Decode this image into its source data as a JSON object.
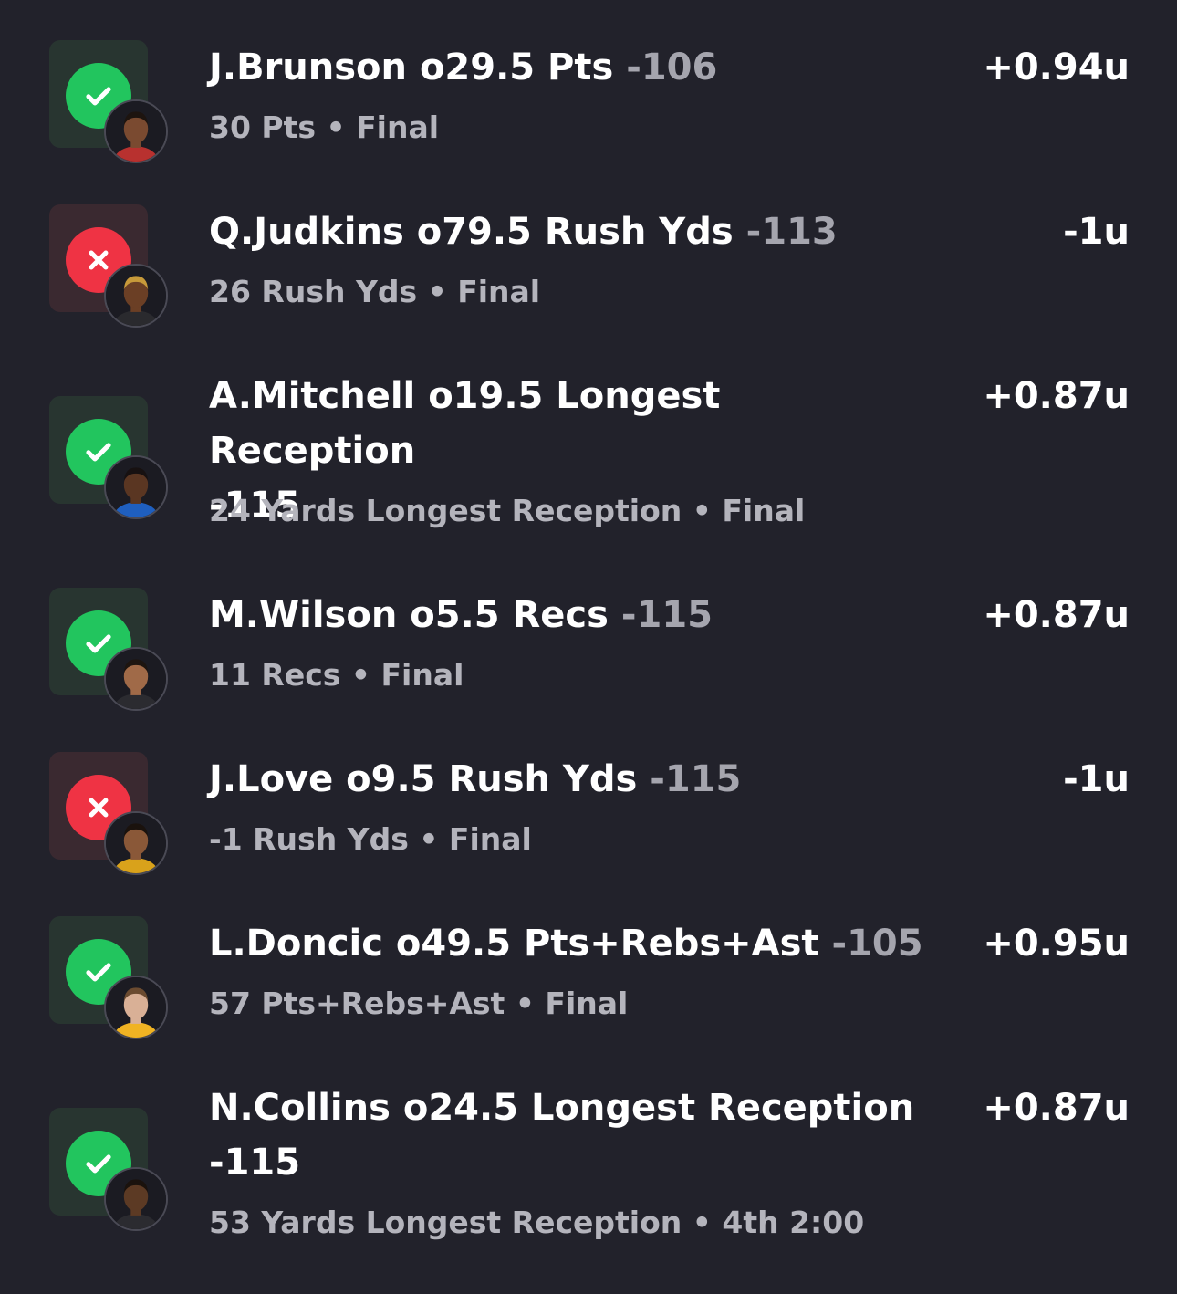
{
  "bets": [
    {
      "player": "J.Brunson o29.5 Pts",
      "odds": "-106",
      "result": "30 Pts",
      "status": "Final",
      "units": "+0.94u",
      "outcome": "win",
      "avatar_colors": {
        "skin": "#7a4a30",
        "hair": "#1d140f",
        "jersey": "#b8312f"
      }
    },
    {
      "player": "Q.Judkins o79.5 Rush Yds",
      "odds": "-113",
      "result": "26 Rush Yds",
      "status": "Final",
      "units": "-1u",
      "outcome": "loss",
      "avatar_colors": {
        "skin": "#6b3f25",
        "hair": "#c79a3a",
        "jersey": "#2a2a2e"
      }
    },
    {
      "player": "A.Mitchell o19.5 Longest Reception",
      "odds": "-115",
      "result": "24 Yards Longest Reception",
      "status": "Final",
      "units": "+0.87u",
      "outcome": "win",
      "avatar_colors": {
        "skin": "#5a3622",
        "hair": "#171111",
        "jersey": "#1f5fbf"
      }
    },
    {
      "player": "M.Wilson o5.5 Recs",
      "odds": "-115",
      "result": "11 Recs",
      "status": "Final",
      "units": "+0.87u",
      "outcome": "win",
      "avatar_colors": {
        "skin": "#a06a48",
        "hair": "#1d1510",
        "jersey": "#2b2b30"
      }
    },
    {
      "player": "J.Love o9.5 Rush Yds",
      "odds": "-115",
      "result": "-1 Rush Yds",
      "status": "Final",
      "units": "-1u",
      "outcome": "loss",
      "avatar_colors": {
        "skin": "#8a5838",
        "hair": "#1a120d",
        "jersey": "#d9a21b"
      }
    },
    {
      "player": "L.Doncic o49.5 Pts+Rebs+Ast",
      "odds": "-105",
      "result": "57 Pts+Rebs+Ast",
      "status": "Final",
      "units": "+0.95u",
      "outcome": "win",
      "avatar_colors": {
        "skin": "#d9b096",
        "hair": "#6b4b30",
        "jersey": "#f0b323"
      }
    },
    {
      "player": "N.Collins o24.5 Longest Reception",
      "odds": "-115",
      "result": "53 Yards Longest Reception",
      "status": "4th 2:00",
      "units": "+0.87u",
      "outcome": "win",
      "avatar_colors": {
        "skin": "#5c3a24",
        "hair": "#1a120d",
        "jersey": "#2b2b30"
      }
    }
  ],
  "separator": " • ",
  "icons": {
    "win": "checkmark-icon",
    "loss": "x-icon"
  },
  "colors": {
    "background": "#22222b",
    "win": "#22c55e",
    "loss": "#ef3344",
    "muted": "#b4b4bc"
  }
}
